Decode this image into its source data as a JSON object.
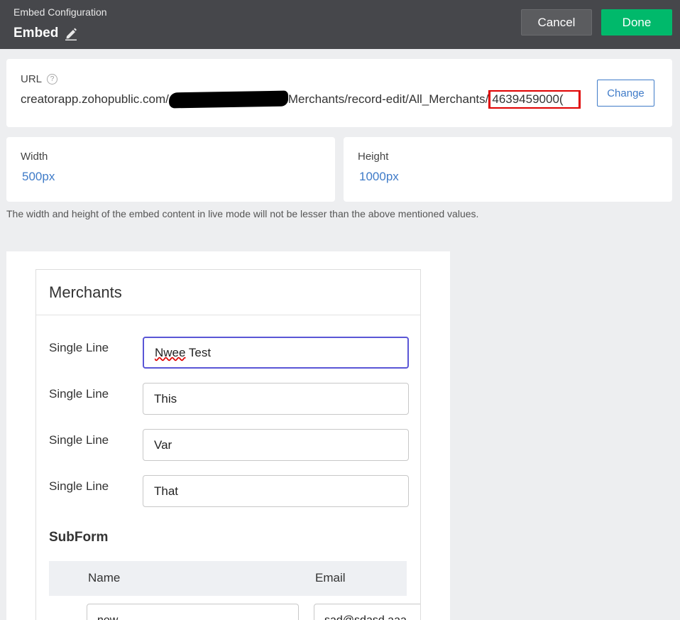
{
  "header": {
    "subtitle": "Embed Configuration",
    "title": "Embed",
    "cancel_label": "Cancel",
    "done_label": "Done"
  },
  "url": {
    "label": "URL",
    "prefix": "creatorapp.zohopublic.com/",
    "middle": "Merchants/record-edit/All_Merchants/",
    "record_id": "4639459000(",
    "change_label": "Change"
  },
  "dimensions": {
    "width_label": "Width",
    "width_value": "500px",
    "height_label": "Height",
    "height_value": "1000px",
    "note": "The width and height of the embed content in live mode will not be lesser than the above mentioned values."
  },
  "form": {
    "title": "Merchants",
    "fields": [
      {
        "label": "Single Line",
        "value": "Nwee Test"
      },
      {
        "label": "Single Line",
        "value": "This"
      },
      {
        "label": "Single Line",
        "value": "Var"
      },
      {
        "label": "Single Line",
        "value": "That"
      }
    ],
    "first_value_word1": "Nwee",
    "first_value_word2": " Test",
    "subform": {
      "title": "SubForm",
      "columns": [
        "Name",
        "Email"
      ],
      "row": {
        "name": "new",
        "email": "sad@sdasd.aaa"
      }
    }
  },
  "colors": {
    "header_bg": "#46474b",
    "done_green": "#00b96b",
    "link_blue": "#3f7bc8",
    "highlight_red": "#e00000",
    "focus_purple": "#5a56d6"
  }
}
